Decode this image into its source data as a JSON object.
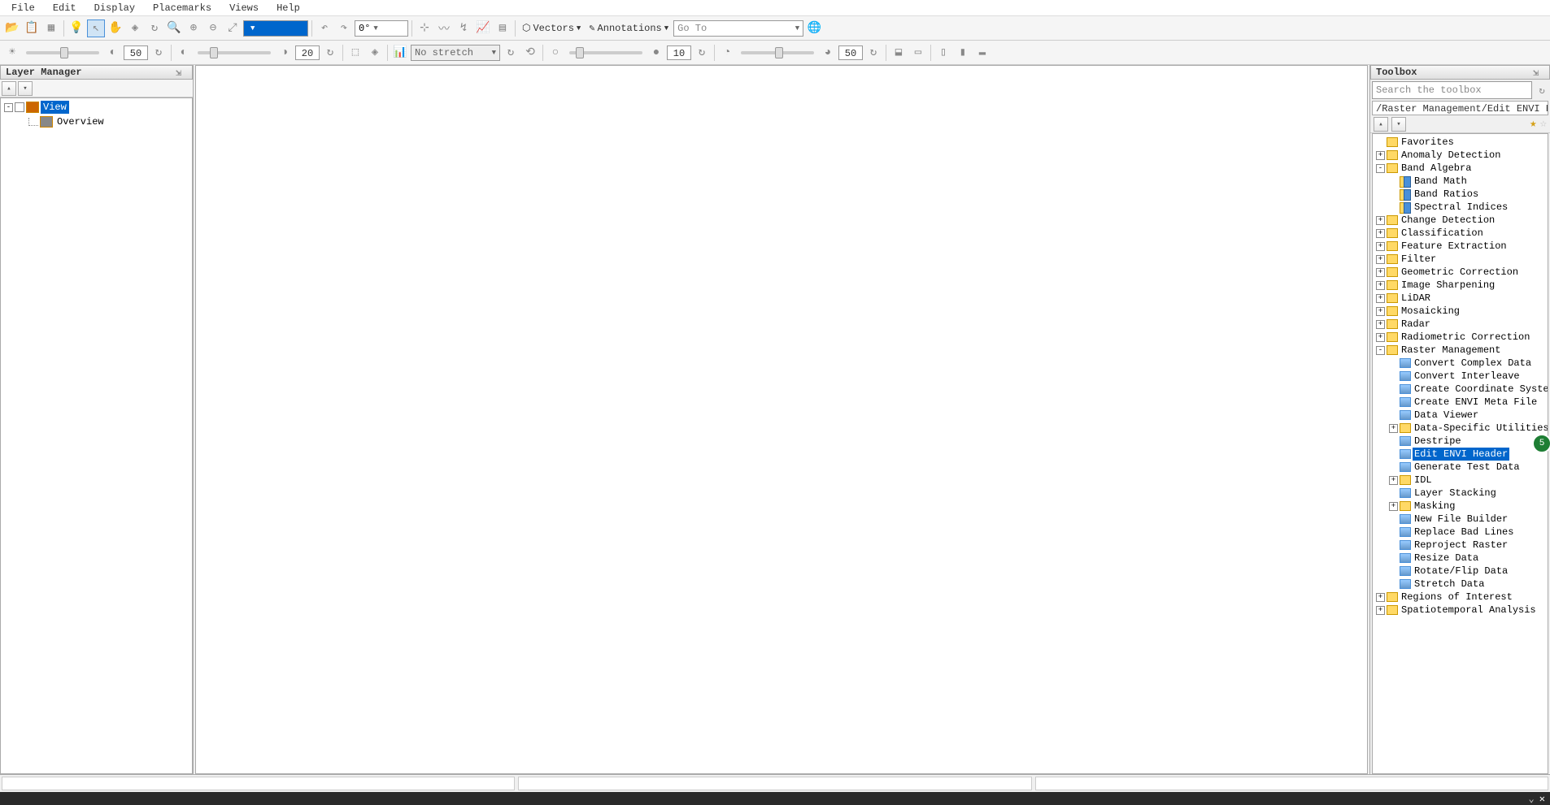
{
  "menu": {
    "items": [
      "File",
      "Edit",
      "Display",
      "Placemarks",
      "Views",
      "Help"
    ]
  },
  "toolbar1": {
    "selector_value": "",
    "angle_value": "0°",
    "vectors_label": "Vectors",
    "annotations_label": "Annotations",
    "goto_placeholder": "Go To"
  },
  "toolbar2": {
    "slider1_value": "50",
    "slider2_value": "20",
    "stretch_label": "No stretch",
    "slider3_value": "10",
    "slider4_value": "50"
  },
  "layer_panel": {
    "title": "Layer Manager",
    "root": "View",
    "child": "Overview"
  },
  "toolbox_panel": {
    "title": "Toolbox",
    "search_placeholder": "Search the toolbox",
    "path": "/Raster Management/Edit ENVI Header",
    "tree": [
      {
        "level": 0,
        "exp": "",
        "icon": "folder",
        "label": "Favorites"
      },
      {
        "level": 0,
        "exp": "+",
        "icon": "folder",
        "label": "Anomaly Detection"
      },
      {
        "level": 0,
        "exp": "-",
        "icon": "folder",
        "label": "Band Algebra"
      },
      {
        "level": 1,
        "exp": "",
        "icon": "yb",
        "label": "Band Math"
      },
      {
        "level": 1,
        "exp": "",
        "icon": "yb",
        "label": "Band Ratios"
      },
      {
        "level": 1,
        "exp": "",
        "icon": "yb",
        "label": "Spectral Indices"
      },
      {
        "level": 0,
        "exp": "+",
        "icon": "folder",
        "label": "Change Detection"
      },
      {
        "level": 0,
        "exp": "+",
        "icon": "folder",
        "label": "Classification"
      },
      {
        "level": 0,
        "exp": "+",
        "icon": "folder",
        "label": "Feature Extraction"
      },
      {
        "level": 0,
        "exp": "+",
        "icon": "folder",
        "label": "Filter"
      },
      {
        "level": 0,
        "exp": "+",
        "icon": "folder",
        "label": "Geometric Correction"
      },
      {
        "level": 0,
        "exp": "+",
        "icon": "folder",
        "label": "Image Sharpening"
      },
      {
        "level": 0,
        "exp": "+",
        "icon": "folder",
        "label": "LiDAR"
      },
      {
        "level": 0,
        "exp": "+",
        "icon": "folder",
        "label": "Mosaicking"
      },
      {
        "level": 0,
        "exp": "+",
        "icon": "folder",
        "label": "Radar"
      },
      {
        "level": 0,
        "exp": "+",
        "icon": "folder",
        "label": "Radiometric Correction"
      },
      {
        "level": 0,
        "exp": "-",
        "icon": "folder",
        "label": "Raster Management"
      },
      {
        "level": 1,
        "exp": "",
        "icon": "tool",
        "label": "Convert Complex Data"
      },
      {
        "level": 1,
        "exp": "",
        "icon": "tool",
        "label": "Convert Interleave"
      },
      {
        "level": 1,
        "exp": "",
        "icon": "tool",
        "label": "Create Coordinate System St"
      },
      {
        "level": 1,
        "exp": "",
        "icon": "tool",
        "label": "Create ENVI Meta File"
      },
      {
        "level": 1,
        "exp": "",
        "icon": "tool",
        "label": "Data Viewer"
      },
      {
        "level": 1,
        "exp": "+",
        "icon": "folder",
        "label": "Data-Specific Utilities"
      },
      {
        "level": 1,
        "exp": "",
        "icon": "tool",
        "label": "Destripe"
      },
      {
        "level": 1,
        "exp": "",
        "icon": "tool",
        "label": "Edit ENVI Header",
        "selected": true
      },
      {
        "level": 1,
        "exp": "",
        "icon": "tool",
        "label": "Generate Test Data"
      },
      {
        "level": 1,
        "exp": "+",
        "icon": "folder",
        "label": "IDL"
      },
      {
        "level": 1,
        "exp": "",
        "icon": "tool",
        "label": "Layer Stacking"
      },
      {
        "level": 1,
        "exp": "+",
        "icon": "folder",
        "label": "Masking"
      },
      {
        "level": 1,
        "exp": "",
        "icon": "tool",
        "label": "New File Builder"
      },
      {
        "level": 1,
        "exp": "",
        "icon": "tool",
        "label": "Replace Bad Lines"
      },
      {
        "level": 1,
        "exp": "",
        "icon": "tool",
        "label": "Reproject Raster"
      },
      {
        "level": 1,
        "exp": "",
        "icon": "tool",
        "label": "Resize Data"
      },
      {
        "level": 1,
        "exp": "",
        "icon": "tool",
        "label": "Rotate/Flip Data"
      },
      {
        "level": 1,
        "exp": "",
        "icon": "tool",
        "label": "Stretch Data"
      },
      {
        "level": 0,
        "exp": "+",
        "icon": "folder",
        "label": "Regions of Interest"
      },
      {
        "level": 0,
        "exp": "+",
        "icon": "folder",
        "label": "Spatiotemporal Analysis"
      }
    ]
  },
  "floating_badge": "5"
}
